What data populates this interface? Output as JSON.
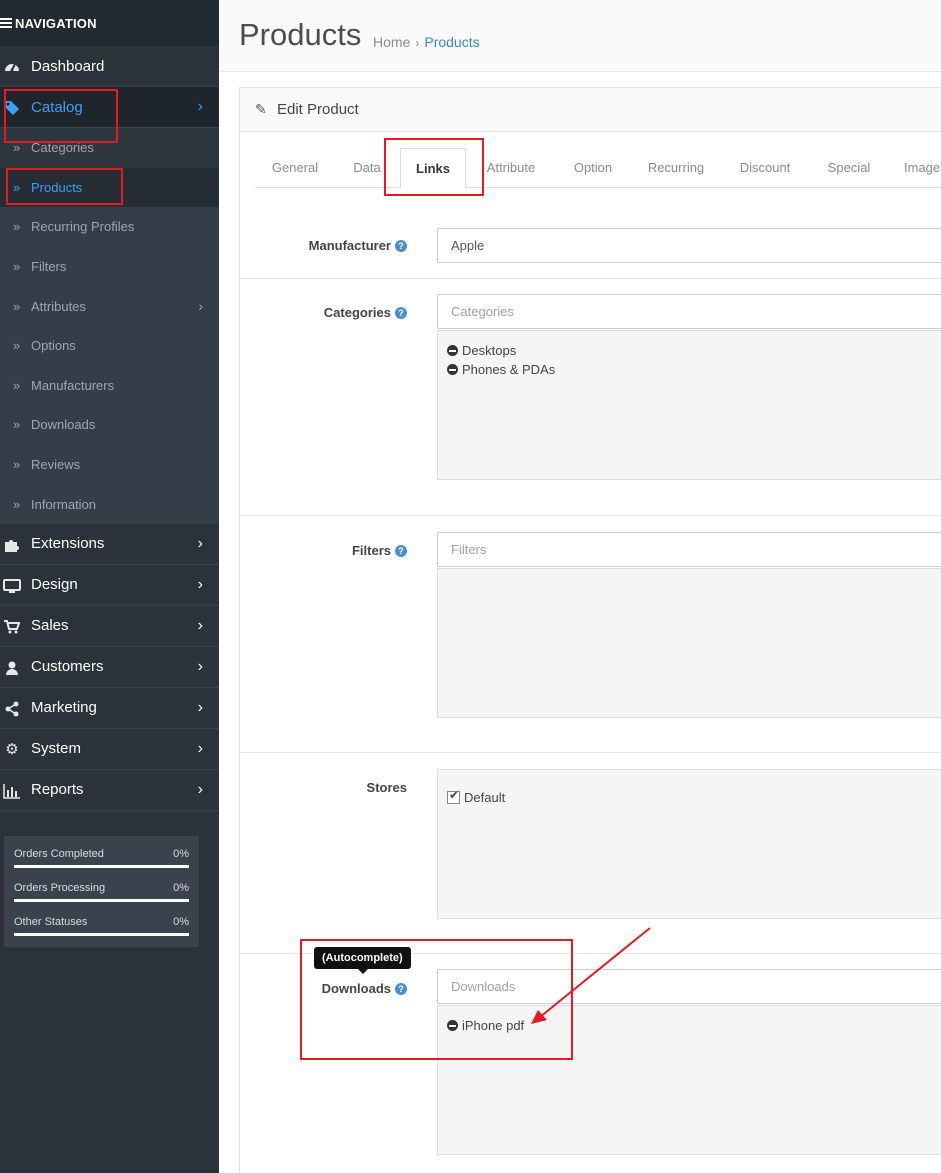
{
  "sidebar": {
    "header": "NAVIGATION",
    "menu": [
      {
        "label": "Dashboard",
        "icon": "dashboard-icon"
      },
      {
        "label": "Catalog",
        "icon": "tags-icon"
      }
    ],
    "catalog_sub": [
      {
        "label": "Categories"
      },
      {
        "label": "Products"
      },
      {
        "label": "Recurring Profiles"
      },
      {
        "label": "Filters"
      },
      {
        "label": "Attributes"
      },
      {
        "label": "Options"
      },
      {
        "label": "Manufacturers"
      },
      {
        "label": "Downloads"
      },
      {
        "label": "Reviews"
      },
      {
        "label": "Information"
      }
    ],
    "lower_menu": [
      {
        "label": "Extensions",
        "icon": "puzzle-icon"
      },
      {
        "label": "Design",
        "icon": "monitor-icon"
      },
      {
        "label": "Sales",
        "icon": "cart-icon"
      },
      {
        "label": "Customers",
        "icon": "user-icon"
      },
      {
        "label": "Marketing",
        "icon": "share-icon"
      },
      {
        "label": "System",
        "icon": "gear-icon"
      },
      {
        "label": "Reports",
        "icon": "bar-chart-icon"
      }
    ],
    "stats": [
      {
        "label": "Orders Completed",
        "value": "0%",
        "progress": 0
      },
      {
        "label": "Orders Processing",
        "value": "0%",
        "progress": 0
      },
      {
        "label": "Other Statuses",
        "value": "0%",
        "progress": 0
      }
    ]
  },
  "header": {
    "title": "Products",
    "breadcrumb": [
      {
        "label": "Home"
      },
      {
        "label": "Products"
      }
    ]
  },
  "panel": {
    "title": "Edit Product",
    "tabs": [
      "General",
      "Data",
      "Links",
      "Attribute",
      "Option",
      "Recurring",
      "Discount",
      "Special",
      "Image"
    ],
    "active_tab": "Links"
  },
  "form": {
    "manufacturer": {
      "label": "Manufacturer",
      "value": "Apple"
    },
    "categories": {
      "label": "Categories",
      "placeholder": "Categories",
      "items": [
        "Desktops",
        "Phones & PDAs"
      ]
    },
    "filters": {
      "label": "Filters",
      "placeholder": "Filters"
    },
    "stores": {
      "label": "Stores",
      "items": [
        "Default"
      ]
    },
    "downloads": {
      "label": "Downloads",
      "placeholder": "Downloads",
      "items": [
        "iPhone pdf"
      ],
      "tooltip": "(Autocomplete)"
    }
  },
  "colors": {
    "sidebar_bg": "#2b323a",
    "accent": "#3e9ff6",
    "annotation": "#e31b23"
  }
}
